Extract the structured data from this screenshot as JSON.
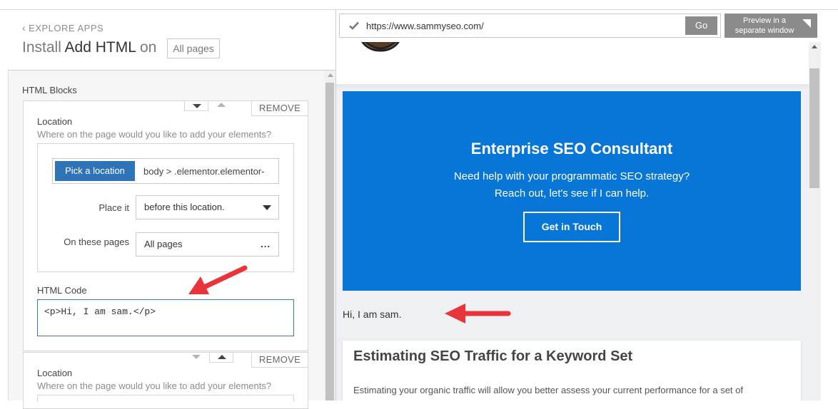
{
  "left_panel": {
    "back_link": "EXPLORE APPS",
    "title_prefix": "Install",
    "app_name": "Add HTML",
    "title_on": "on",
    "scope": "All pages",
    "section_heading": "HTML Blocks",
    "blocks": [
      {
        "remove_label": "REMOVE",
        "location_label": "Location",
        "location_hint": "Where on the page would you like to add your elements?",
        "pick_button": "Pick a location",
        "selector_value": "body > .elementor.elementor-",
        "place_label": "Place it",
        "place_value": "before this location.",
        "pages_label": "On these pages",
        "pages_value": "All pages",
        "pages_more": "...",
        "code_label": "HTML Code",
        "code_value": "<p>Hi, I am sam.</p>"
      },
      {
        "remove_label": "REMOVE",
        "location_label": "Location",
        "location_hint": "Where on the page would you like to add your elements?"
      }
    ]
  },
  "preview": {
    "url": "https://www.sammyseo.com/",
    "go_label": "Go",
    "new_window_label": "Preview in a separate window",
    "cta": {
      "title": "Enterprise SEO Consultant",
      "line1": "Need help with your programmatic SEO strategy?",
      "line2": "Reach out, let's see if I can help.",
      "button": "Get in Touch"
    },
    "injected_text": "Hi, I am sam.",
    "post": {
      "title": "Estimating SEO Traffic for a Keyword Set",
      "excerpt": "Estimating your organic traffic will allow you better assess your current performance for a set of"
    }
  },
  "colors": {
    "primary_blue": "#0876d6",
    "pick_button_blue": "#2f74b9",
    "annotation_red": "#e8343a",
    "button_gray": "#8b8b8b"
  },
  "icons": [
    "chevron-left-icon",
    "caret-down-icon",
    "caret-up-icon",
    "check-icon",
    "external-window-icon",
    "annotation-arrow"
  ]
}
